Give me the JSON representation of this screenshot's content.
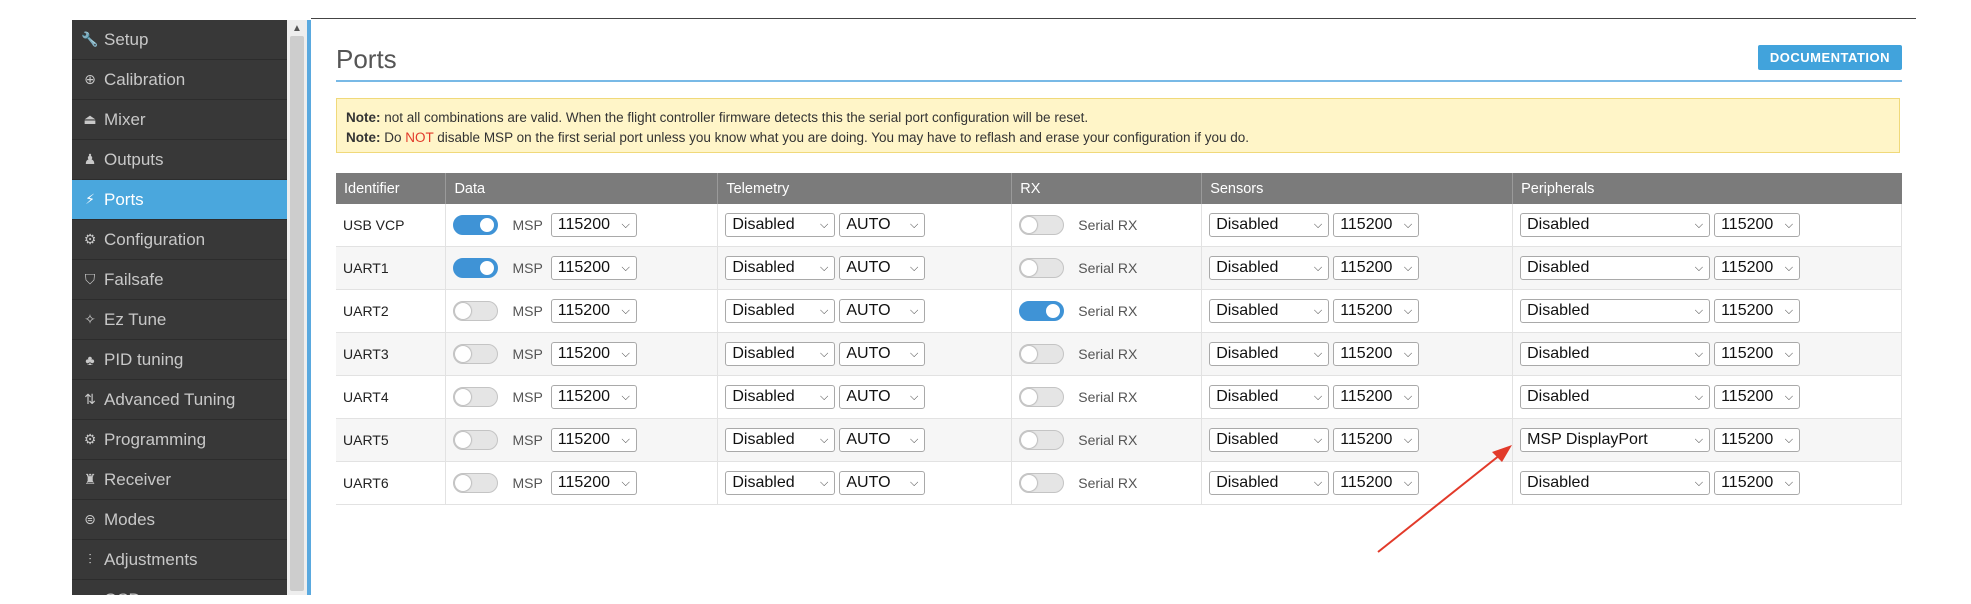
{
  "sidebar": {
    "items": [
      {
        "label": "Setup",
        "icon": "wrench-icon",
        "glyph": "🔧",
        "active": false
      },
      {
        "label": "Calibration",
        "icon": "crosshair-icon",
        "glyph": "⊕",
        "active": false
      },
      {
        "label": "Mixer",
        "icon": "mixer-icon",
        "glyph": "⏏",
        "active": false
      },
      {
        "label": "Outputs",
        "icon": "outputs-icon",
        "glyph": "♟",
        "active": false
      },
      {
        "label": "Ports",
        "icon": "plug-icon",
        "glyph": "⚡",
        "active": true
      },
      {
        "label": "Configuration",
        "icon": "gear-icon",
        "glyph": "⚙",
        "active": false
      },
      {
        "label": "Failsafe",
        "icon": "failsafe-icon",
        "glyph": "⛉",
        "active": false
      },
      {
        "label": "Ez Tune",
        "icon": "wand-icon",
        "glyph": "✧",
        "active": false
      },
      {
        "label": "PID tuning",
        "icon": "pid-icon",
        "glyph": "♣",
        "active": false
      },
      {
        "label": "Advanced Tuning",
        "icon": "advanced-tuning-icon",
        "glyph": "⇅",
        "active": false
      },
      {
        "label": "Programming",
        "icon": "cog-icon",
        "glyph": "⚙",
        "active": false
      },
      {
        "label": "Receiver",
        "icon": "receiver-icon",
        "glyph": "♜",
        "active": false
      },
      {
        "label": "Modes",
        "icon": "modes-icon",
        "glyph": "⊜",
        "active": false
      },
      {
        "label": "Adjustments",
        "icon": "sliders-icon",
        "glyph": "⫶",
        "active": false
      },
      {
        "label": "OSD",
        "icon": "osd-icon",
        "glyph": "▭",
        "active": false
      }
    ]
  },
  "page": {
    "title": "Ports",
    "doc_button": "DOCUMENTATION"
  },
  "note": {
    "line1_label": "Note:",
    "line1_text": " not all combinations are valid. When the flight controller firmware detects this the serial port configuration will be reset.",
    "line2_label": "Note:",
    "line2_pre": " Do ",
    "line2_red": "NOT",
    "line2_post": " disable MSP on the first serial port unless you know what you are doing. You may have to reflash and erase your configuration if you do."
  },
  "table": {
    "headers": [
      "Identifier",
      "Data",
      "Telemetry",
      "RX",
      "Sensors",
      "Peripherals"
    ],
    "msp_label": "MSP",
    "rx_label": "Serial RX",
    "rows": [
      {
        "id": "USB VCP",
        "msp_on": true,
        "msp_baud": "115200",
        "tel": "Disabled",
        "tel_baud": "AUTO",
        "rx_on": false,
        "sens": "Disabled",
        "sens_baud": "115200",
        "peri": "Disabled",
        "peri_baud": "115200"
      },
      {
        "id": "UART1",
        "msp_on": true,
        "msp_baud": "115200",
        "tel": "Disabled",
        "tel_baud": "AUTO",
        "rx_on": false,
        "sens": "Disabled",
        "sens_baud": "115200",
        "peri": "Disabled",
        "peri_baud": "115200"
      },
      {
        "id": "UART2",
        "msp_on": false,
        "msp_baud": "115200",
        "tel": "Disabled",
        "tel_baud": "AUTO",
        "rx_on": true,
        "sens": "Disabled",
        "sens_baud": "115200",
        "peri": "Disabled",
        "peri_baud": "115200"
      },
      {
        "id": "UART3",
        "msp_on": false,
        "msp_baud": "115200",
        "tel": "Disabled",
        "tel_baud": "AUTO",
        "rx_on": false,
        "sens": "Disabled",
        "sens_baud": "115200",
        "peri": "Disabled",
        "peri_baud": "115200"
      },
      {
        "id": "UART4",
        "msp_on": false,
        "msp_baud": "115200",
        "tel": "Disabled",
        "tel_baud": "AUTO",
        "rx_on": false,
        "sens": "Disabled",
        "sens_baud": "115200",
        "peri": "Disabled",
        "peri_baud": "115200"
      },
      {
        "id": "UART5",
        "msp_on": false,
        "msp_baud": "115200",
        "tel": "Disabled",
        "tel_baud": "AUTO",
        "rx_on": false,
        "sens": "Disabled",
        "sens_baud": "115200",
        "peri": "MSP DisplayPort",
        "peri_baud": "115200"
      },
      {
        "id": "UART6",
        "msp_on": false,
        "msp_baud": "115200",
        "tel": "Disabled",
        "tel_baud": "AUTO",
        "rx_on": false,
        "sens": "Disabled",
        "sens_baud": "115200",
        "peri": "Disabled",
        "peri_baud": "115200"
      }
    ]
  },
  "colors": {
    "accent": "#41a3dc",
    "active_sidebar": "#4aa7dd",
    "toggle_on": "#3f93d6",
    "arrow": "#e23a2a"
  }
}
